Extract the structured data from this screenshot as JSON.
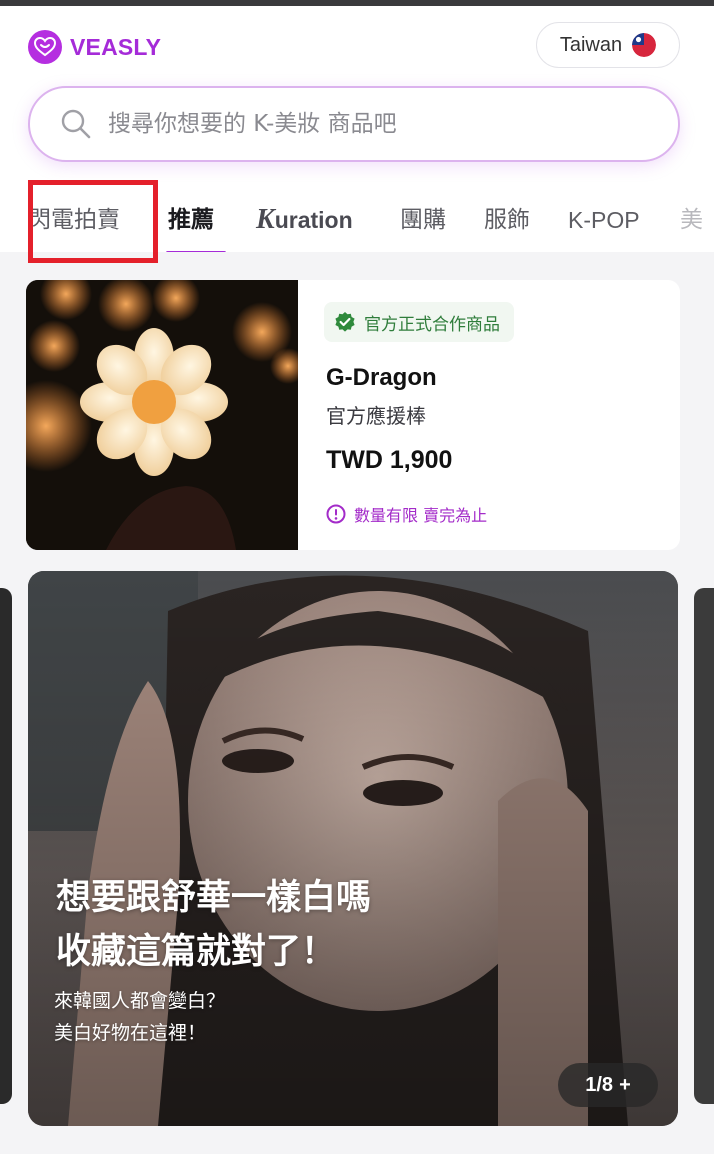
{
  "app": {
    "brand": "VEASLY",
    "brand_color": "#a52bd8"
  },
  "header": {
    "region_label": "Taiwan",
    "region_flag_icon": "taiwan-flag-icon"
  },
  "search": {
    "placeholder": "搜尋你想要的 K-美妝 商品吧",
    "value": ""
  },
  "tabs": [
    {
      "label": "閃電拍賣",
      "active": false
    },
    {
      "label": "推薦",
      "active": true
    },
    {
      "label": "Kuration",
      "active": false
    },
    {
      "label": "團購",
      "active": false
    },
    {
      "label": "服飾",
      "active": false
    },
    {
      "label": "K-POP",
      "active": false
    },
    {
      "label": "美",
      "active": false
    }
  ],
  "kuration_tab": {
    "k": "K",
    "rest": "uration"
  },
  "product": {
    "badge": "官方正式合作商品",
    "name": "G-Dragon",
    "subtitle": "官方應援棒",
    "price": "TWD 1,900",
    "note": "數量有限 賣完為止"
  },
  "banner": {
    "title_line1": "想要跟舒華一樣白嗎",
    "title_line2": "收藏這篇就對了！",
    "sub_line1": "來韓國人都會變白？",
    "sub_line2": "美白好物在這裡！",
    "pager": "1/8",
    "pager_plus": "+"
  }
}
